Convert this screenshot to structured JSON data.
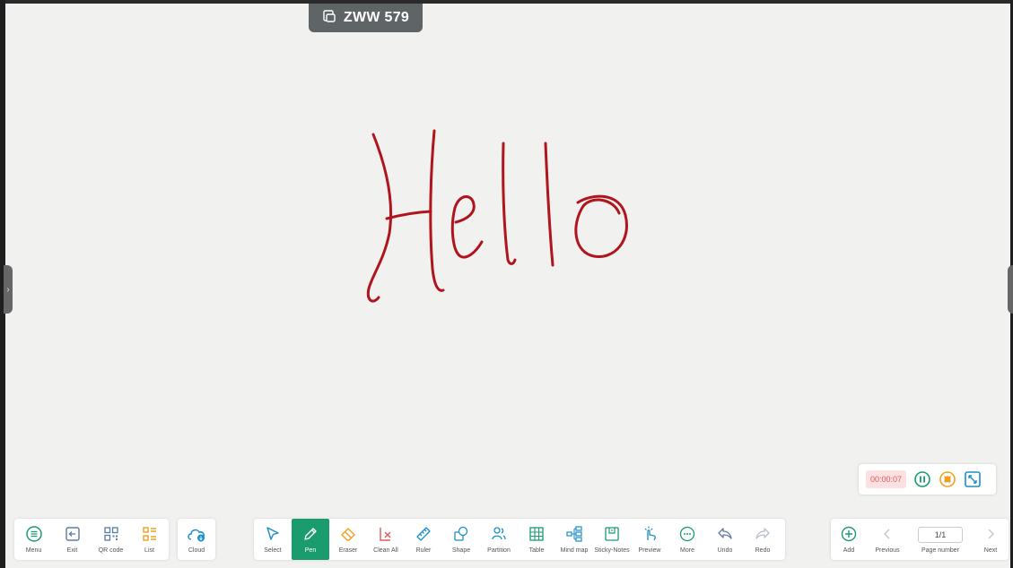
{
  "room": {
    "name": "ZWW 579",
    "icon": "screen-share-icon"
  },
  "timer": {
    "elapsed": "00:00:07"
  },
  "colors": {
    "accent": "#1a9c6e",
    "ink": "#b0151d",
    "timer_text": "#e05a5a",
    "pause": "#1a9c6e",
    "stop": "#f0a020",
    "expand": "#1a8fc9"
  },
  "canvas": {
    "handwriting": "Hello"
  },
  "left_panel": {
    "items": [
      {
        "label": "Menu",
        "icon": "menu-icon"
      },
      {
        "label": "Exit",
        "icon": "exit-icon"
      },
      {
        "label": "QR code",
        "icon": "qr-code-icon"
      },
      {
        "label": "List",
        "icon": "list-icon"
      }
    ]
  },
  "cloud_panel": {
    "label": "Cloud",
    "icon": "cloud-icon"
  },
  "tools": {
    "items": [
      {
        "label": "Select",
        "icon": "select-icon"
      },
      {
        "label": "Pen",
        "icon": "pen-icon",
        "active": true
      },
      {
        "label": "Eraser",
        "icon": "eraser-icon"
      },
      {
        "label": "Clean All",
        "icon": "clean-all-icon"
      },
      {
        "label": "Ruler",
        "icon": "ruler-icon"
      },
      {
        "label": "Shape",
        "icon": "shape-icon"
      },
      {
        "label": "Partition",
        "icon": "partition-icon"
      },
      {
        "label": "Table",
        "icon": "table-icon"
      },
      {
        "label": "Mind map",
        "icon": "mind-map-icon"
      },
      {
        "label": "Sticky-Notes",
        "icon": "sticky-notes-icon"
      },
      {
        "label": "Preview",
        "icon": "preview-icon"
      },
      {
        "label": "More",
        "icon": "more-icon"
      },
      {
        "label": "Undo",
        "icon": "undo-icon"
      },
      {
        "label": "Redo",
        "icon": "redo-icon"
      }
    ]
  },
  "page_panel": {
    "add_label": "Add",
    "previous_label": "Previous",
    "page_number_label": "Page number",
    "page_value": "1/1",
    "next_label": "Next"
  }
}
